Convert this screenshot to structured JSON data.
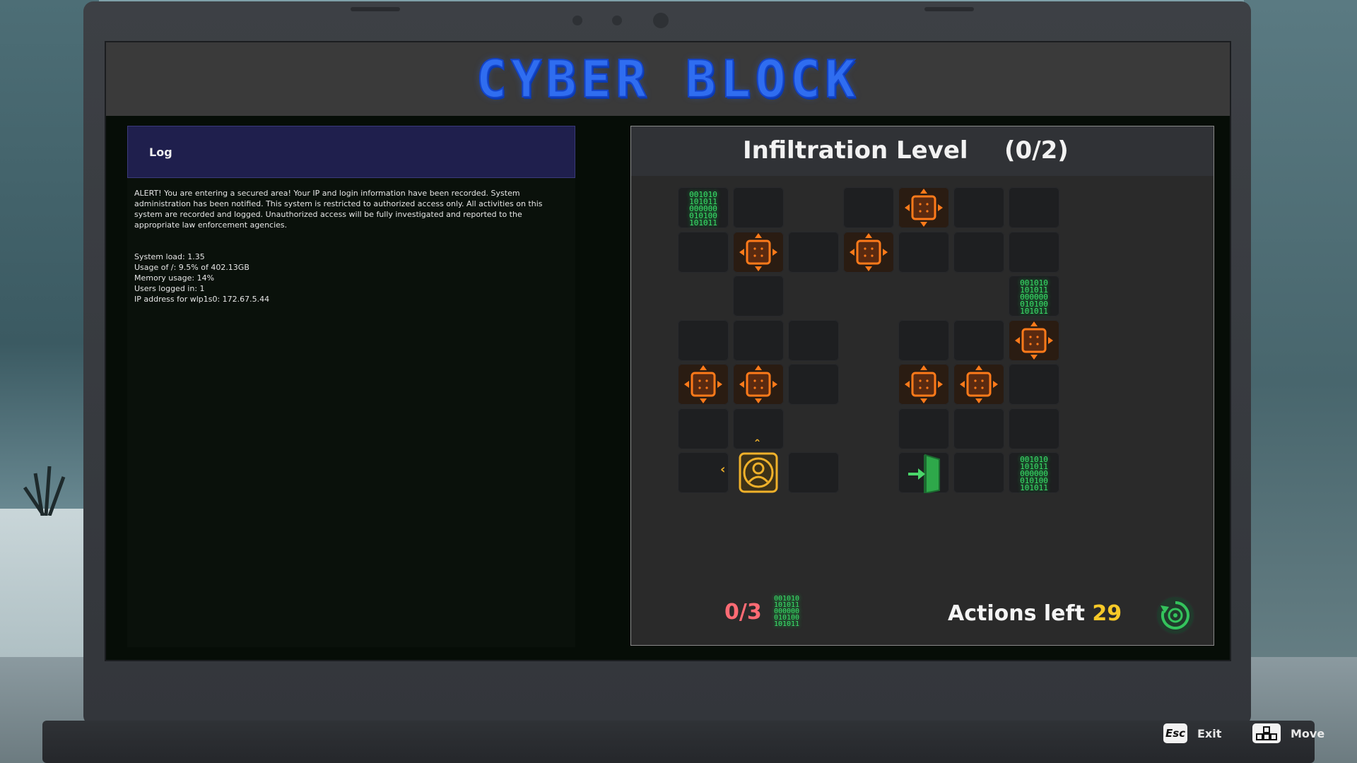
{
  "game": {
    "title": "CYBER BLOCK"
  },
  "log": {
    "header": "Log",
    "alert": "ALERT! You are entering a secured area! Your IP and login information have been recorded. System administration has been notified. This system is restricted to authorized access only. All activities on this system are recorded and logged. Unauthorized access will be fully investigated and reported to the appropriate law enforcement agencies.",
    "stats": [
      "System load: 1.35",
      "Usage of /: 9.5% of 402.13GB",
      "Memory usage: 14%",
      "Users logged in: 1",
      "IP address for wlp1s0: 172.67.5.44"
    ]
  },
  "level": {
    "name": "Infiltration Level",
    "progress": "(0/2)"
  },
  "grid": {
    "binary_text": [
      "001010",
      "101011",
      "000000",
      "010100",
      "101011"
    ],
    "cells": [
      {
        "col": 0,
        "row": 0,
        "kind": "data"
      },
      {
        "col": 1,
        "row": 0,
        "kind": "empty"
      },
      {
        "col": 3,
        "row": 0,
        "kind": "empty"
      },
      {
        "col": 4,
        "row": 0,
        "kind": "mover"
      },
      {
        "col": 5,
        "row": 0,
        "kind": "empty"
      },
      {
        "col": 6,
        "row": 0,
        "kind": "empty"
      },
      {
        "col": 0,
        "row": 1,
        "kind": "empty"
      },
      {
        "col": 1,
        "row": 1,
        "kind": "mover"
      },
      {
        "col": 2,
        "row": 1,
        "kind": "empty"
      },
      {
        "col": 3,
        "row": 1,
        "kind": "mover"
      },
      {
        "col": 4,
        "row": 1,
        "kind": "empty"
      },
      {
        "col": 5,
        "row": 1,
        "kind": "empty"
      },
      {
        "col": 6,
        "row": 1,
        "kind": "empty"
      },
      {
        "col": 1,
        "row": 2,
        "kind": "empty"
      },
      {
        "col": 6,
        "row": 2,
        "kind": "data"
      },
      {
        "col": 0,
        "row": 3,
        "kind": "empty"
      },
      {
        "col": 1,
        "row": 3,
        "kind": "empty"
      },
      {
        "col": 2,
        "row": 3,
        "kind": "empty"
      },
      {
        "col": 4,
        "row": 3,
        "kind": "empty"
      },
      {
        "col": 5,
        "row": 3,
        "kind": "empty"
      },
      {
        "col": 6,
        "row": 3,
        "kind": "mover"
      },
      {
        "col": 0,
        "row": 4,
        "kind": "mover"
      },
      {
        "col": 1,
        "row": 4,
        "kind": "mover"
      },
      {
        "col": 2,
        "row": 4,
        "kind": "empty"
      },
      {
        "col": 4,
        "row": 4,
        "kind": "mover"
      },
      {
        "col": 5,
        "row": 4,
        "kind": "mover"
      },
      {
        "col": 6,
        "row": 4,
        "kind": "empty"
      },
      {
        "col": 0,
        "row": 5,
        "kind": "empty"
      },
      {
        "col": 1,
        "row": 5,
        "kind": "empty"
      },
      {
        "col": 4,
        "row": 5,
        "kind": "empty"
      },
      {
        "col": 5,
        "row": 5,
        "kind": "empty"
      },
      {
        "col": 6,
        "row": 5,
        "kind": "empty"
      },
      {
        "col": 0,
        "row": 6,
        "kind": "empty"
      },
      {
        "col": 1,
        "row": 6,
        "kind": "player"
      },
      {
        "col": 2,
        "row": 6,
        "kind": "empty"
      },
      {
        "col": 4,
        "row": 6,
        "kind": "exit"
      },
      {
        "col": 5,
        "row": 6,
        "kind": "empty"
      },
      {
        "col": 6,
        "row": 6,
        "kind": "data"
      }
    ]
  },
  "status": {
    "collected": "0/3",
    "actions_label": "Actions left",
    "actions_left": "29"
  },
  "colors": {
    "title": "#2f6df0",
    "mover": "#ff7a1a",
    "data": "#3be06a",
    "player": "#f0b12a",
    "exit": "#2ea84a",
    "collected": "#ff6b74",
    "actions": "#f7c928"
  },
  "hints": {
    "exit_key": "Esc",
    "exit_label": "Exit",
    "move_label": "Move"
  }
}
